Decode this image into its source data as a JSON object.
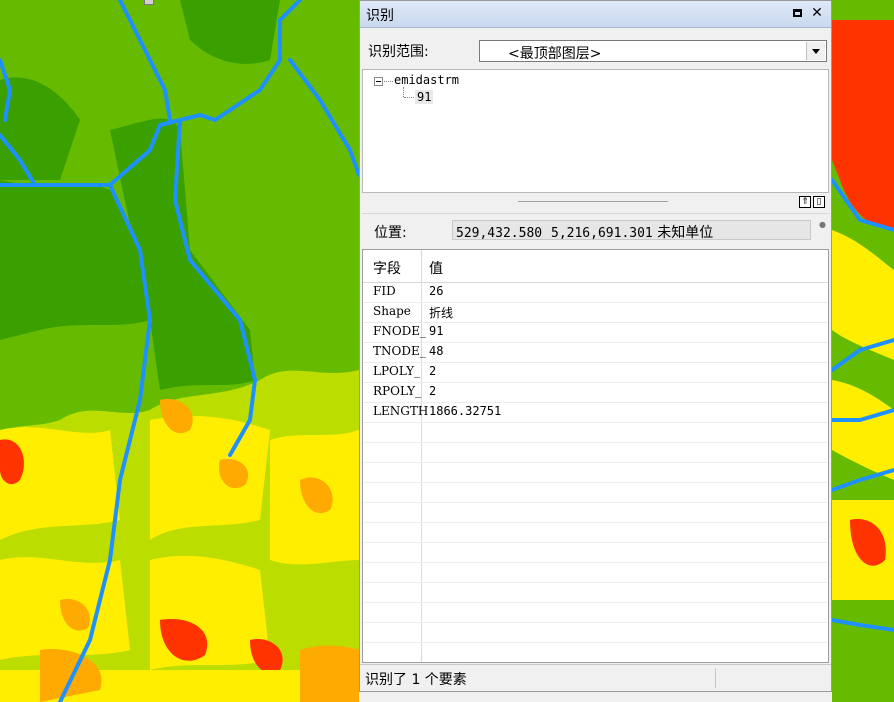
{
  "window": {
    "title": "识别",
    "restore_label": "",
    "close_label": "✕"
  },
  "identify_from": {
    "label": "识别范围:",
    "selected": "<最顶部图层>"
  },
  "tree": {
    "layer": "emidastrm",
    "feature": "91"
  },
  "location": {
    "label": "位置:",
    "x": "529,432.580",
    "y": "5,216,691.301",
    "unit": "未知单位"
  },
  "table": {
    "columns": [
      "字段",
      "值"
    ],
    "rows": [
      {
        "field": "FID",
        "value": "26"
      },
      {
        "field": "Shape",
        "value": "折线"
      },
      {
        "field": "FNODE_",
        "value": "91"
      },
      {
        "field": "TNODE_",
        "value": "48"
      },
      {
        "field": "LPOLY_",
        "value": "2"
      },
      {
        "field": "RPOLY_",
        "value": "2"
      },
      {
        "field": "LENGTH",
        "value": "1866.32751"
      }
    ]
  },
  "status": {
    "text": "识别了 1 个要素"
  },
  "colors": {
    "dark_green": "#3aa000",
    "green": "#66bb00",
    "yellow_green": "#bbdd00",
    "yellow": "#ffee00",
    "orange": "#ffaa00",
    "red": "#ff3300",
    "stream_blue": "#1e90ff",
    "window_bg": "#f0f0f0"
  }
}
